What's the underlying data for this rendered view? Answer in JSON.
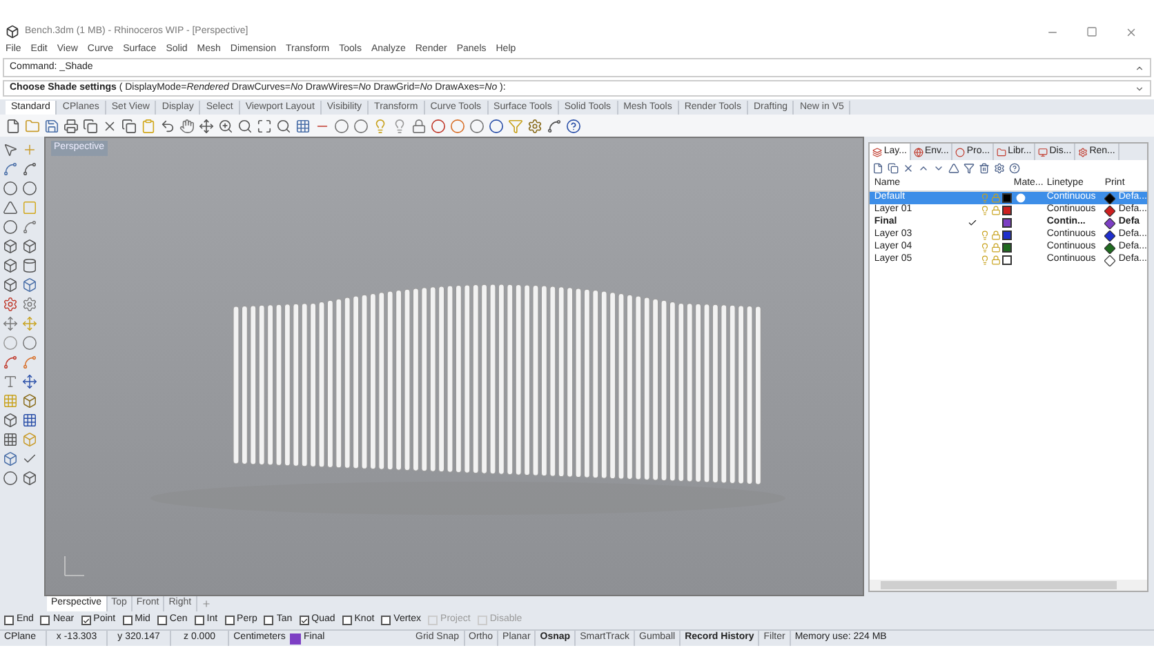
{
  "window": {
    "title": "Bench.3dm (1 MB) - Rhinoceros WIP - [Perspective]"
  },
  "menu": [
    "File",
    "Edit",
    "View",
    "Curve",
    "Surface",
    "Solid",
    "Mesh",
    "Dimension",
    "Transform",
    "Tools",
    "Analyze",
    "Render",
    "Panels",
    "Help"
  ],
  "command": {
    "history": "Command: _Shade",
    "prompt": "**Choose Shade settings** ( DisplayMode=*Rendered*  DrawCurves=*No*  DrawWires=*No*  DrawGrid=*No*  DrawAxes=*No* ):"
  },
  "toolbar_tabs": [
    {
      "label": "Standard",
      "selected": true
    },
    {
      "label": "CPlanes",
      "selected": false
    },
    {
      "label": "Set View",
      "selected": false
    },
    {
      "label": "Display",
      "selected": false
    },
    {
      "label": "Select",
      "selected": false
    },
    {
      "label": "Viewport Layout",
      "selected": false
    },
    {
      "label": "Visibility",
      "selected": false
    },
    {
      "label": "Transform",
      "selected": false
    },
    {
      "label": "Curve Tools",
      "selected": false
    },
    {
      "label": "Surface Tools",
      "selected": false
    },
    {
      "label": "Solid Tools",
      "selected": false
    },
    {
      "label": "Mesh Tools",
      "selected": false
    },
    {
      "label": "Render Tools",
      "selected": false
    },
    {
      "label": "Drafting",
      "selected": false
    },
    {
      "label": "New in V5",
      "selected": false
    }
  ],
  "viewport": {
    "label": "Perspective",
    "tabs": [
      {
        "label": "Perspective",
        "selected": true
      },
      {
        "label": "Top",
        "selected": false
      },
      {
        "label": "Front",
        "selected": false
      },
      {
        "label": "Right",
        "selected": false
      }
    ]
  },
  "panel": {
    "tabs": [
      {
        "label": "Lay...",
        "selected": true
      },
      {
        "label": "Env...",
        "selected": false
      },
      {
        "label": "Pro...",
        "selected": false
      },
      {
        "label": "Libr...",
        "selected": false
      },
      {
        "label": "Dis...",
        "selected": false
      },
      {
        "label": "Ren...",
        "selected": false
      }
    ],
    "columns": [
      "Name",
      "Mate...",
      "Linetype",
      "Print"
    ],
    "layers": [
      {
        "name": "Default",
        "selected": true,
        "current": false,
        "color": "#000000",
        "linetype": "Continuous",
        "print": "Defa..."
      },
      {
        "name": "Layer 01",
        "selected": false,
        "current": false,
        "color": "#cc1f1f",
        "linetype": "Continuous",
        "print": "Defa..."
      },
      {
        "name": "Final",
        "selected": false,
        "current": true,
        "color": "#7d3fc4",
        "linetype": "Contin...",
        "print": "Defa"
      },
      {
        "name": "Layer 03",
        "selected": false,
        "current": false,
        "color": "#1f2fcc",
        "linetype": "Continuous",
        "print": "Defa..."
      },
      {
        "name": "Layer 04",
        "selected": false,
        "current": false,
        "color": "#1f6a1f",
        "linetype": "Continuous",
        "print": "Defa..."
      },
      {
        "name": "Layer 05",
        "selected": false,
        "current": false,
        "color": "#ffffff",
        "linetype": "Continuous",
        "print": "Defa..."
      }
    ]
  },
  "osnaps": [
    {
      "label": "End",
      "checked": false,
      "disabled": false
    },
    {
      "label": "Near",
      "checked": false,
      "disabled": false
    },
    {
      "label": "Point",
      "checked": true,
      "disabled": false
    },
    {
      "label": "Mid",
      "checked": false,
      "disabled": false
    },
    {
      "label": "Cen",
      "checked": false,
      "disabled": false
    },
    {
      "label": "Int",
      "checked": false,
      "disabled": false
    },
    {
      "label": "Perp",
      "checked": false,
      "disabled": false
    },
    {
      "label": "Tan",
      "checked": false,
      "disabled": false
    },
    {
      "label": "Quad",
      "checked": true,
      "disabled": false
    },
    {
      "label": "Knot",
      "checked": false,
      "disabled": false
    },
    {
      "label": "Vertex",
      "checked": false,
      "disabled": false
    },
    {
      "label": "Project",
      "checked": false,
      "disabled": true
    },
    {
      "label": "Disable",
      "checked": false,
      "disabled": true
    }
  ],
  "status_bar": {
    "cplane": "CPlane",
    "x": "x -13.303",
    "y": "y 320.147",
    "z": "z 0.000",
    "units": "Centimeters",
    "layer": {
      "name": "Final",
      "color": "#7d3fc4"
    },
    "toggles": [
      {
        "label": "Grid Snap",
        "on": false
      },
      {
        "label": "Ortho",
        "on": false
      },
      {
        "label": "Planar",
        "on": false
      },
      {
        "label": "Osnap",
        "on": true
      },
      {
        "label": "SmartTrack",
        "on": false
      },
      {
        "label": "Gumball",
        "on": false
      },
      {
        "label": "Record History",
        "on": true
      },
      {
        "label": "Filter",
        "on": false
      }
    ],
    "memory": "Memory use: 224 MB"
  }
}
